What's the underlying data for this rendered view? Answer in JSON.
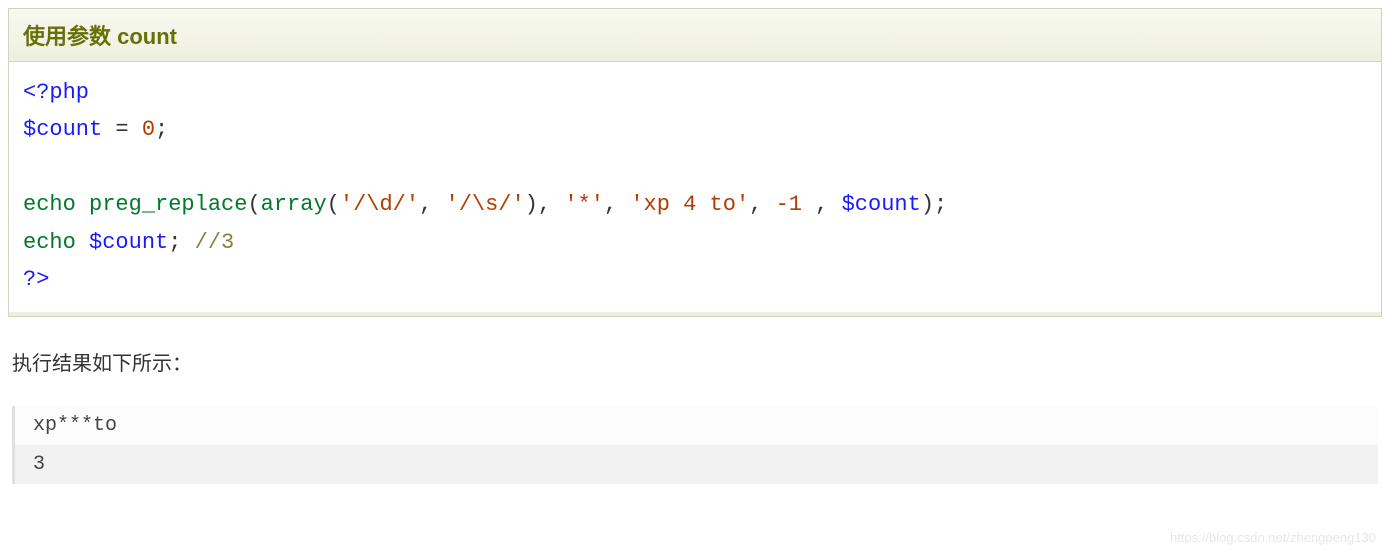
{
  "example": {
    "title": "使用参数 count",
    "code": {
      "open_tag": "<?php",
      "l2_var": "$count",
      "l2_eq": " = ",
      "l2_num": "0",
      "l2_semi": ";",
      "l4_echo": "echo ",
      "l4_func": "preg_replace",
      "l4_p1": "(",
      "l4_array": "array",
      "l4_p2": "(",
      "l4_s1": "'/\\d/'",
      "l4_c1": ", ",
      "l4_s2": "'/\\s/'",
      "l4_p3": ")",
      "l4_c2": ", ",
      "l4_s3": "'*'",
      "l4_c3": ", ",
      "l4_s4": "'xp 4 to'",
      "l4_c4": ", ",
      "l4_n1": "-1",
      "l4_c5": " , ",
      "l4_v2": "$count",
      "l4_p4": ")",
      "l4_semi": ";",
      "l5_echo": "echo ",
      "l5_var": "$count",
      "l5_semi": "; ",
      "l5_cmt": "//3",
      "close_tag": "?>"
    }
  },
  "result_label": "执行结果如下所示：",
  "output": {
    "line1": "xp***to",
    "line2": "3"
  },
  "watermark": "https://blog.csdn.net/zhengpeng130"
}
